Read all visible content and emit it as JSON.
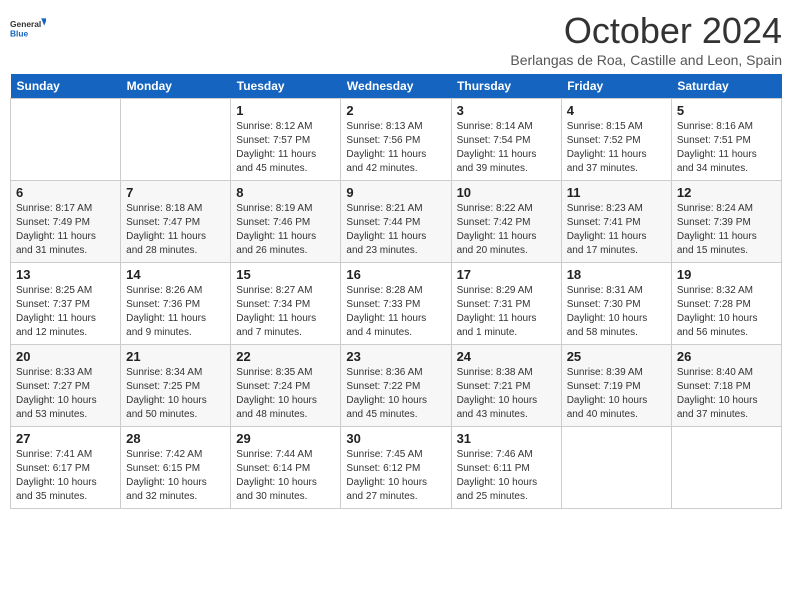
{
  "logo": {
    "line1": "General",
    "line2": "Blue"
  },
  "title": "October 2024",
  "location": "Berlangas de Roa, Castille and Leon, Spain",
  "days_of_week": [
    "Sunday",
    "Monday",
    "Tuesday",
    "Wednesday",
    "Thursday",
    "Friday",
    "Saturday"
  ],
  "weeks": [
    [
      {
        "day": "",
        "sunrise": "",
        "sunset": "",
        "daylight": ""
      },
      {
        "day": "",
        "sunrise": "",
        "sunset": "",
        "daylight": ""
      },
      {
        "day": "1",
        "sunrise": "Sunrise: 8:12 AM",
        "sunset": "Sunset: 7:57 PM",
        "daylight": "Daylight: 11 hours and 45 minutes."
      },
      {
        "day": "2",
        "sunrise": "Sunrise: 8:13 AM",
        "sunset": "Sunset: 7:56 PM",
        "daylight": "Daylight: 11 hours and 42 minutes."
      },
      {
        "day": "3",
        "sunrise": "Sunrise: 8:14 AM",
        "sunset": "Sunset: 7:54 PM",
        "daylight": "Daylight: 11 hours and 39 minutes."
      },
      {
        "day": "4",
        "sunrise": "Sunrise: 8:15 AM",
        "sunset": "Sunset: 7:52 PM",
        "daylight": "Daylight: 11 hours and 37 minutes."
      },
      {
        "day": "5",
        "sunrise": "Sunrise: 8:16 AM",
        "sunset": "Sunset: 7:51 PM",
        "daylight": "Daylight: 11 hours and 34 minutes."
      }
    ],
    [
      {
        "day": "6",
        "sunrise": "Sunrise: 8:17 AM",
        "sunset": "Sunset: 7:49 PM",
        "daylight": "Daylight: 11 hours and 31 minutes."
      },
      {
        "day": "7",
        "sunrise": "Sunrise: 8:18 AM",
        "sunset": "Sunset: 7:47 PM",
        "daylight": "Daylight: 11 hours and 28 minutes."
      },
      {
        "day": "8",
        "sunrise": "Sunrise: 8:19 AM",
        "sunset": "Sunset: 7:46 PM",
        "daylight": "Daylight: 11 hours and 26 minutes."
      },
      {
        "day": "9",
        "sunrise": "Sunrise: 8:21 AM",
        "sunset": "Sunset: 7:44 PM",
        "daylight": "Daylight: 11 hours and 23 minutes."
      },
      {
        "day": "10",
        "sunrise": "Sunrise: 8:22 AM",
        "sunset": "Sunset: 7:42 PM",
        "daylight": "Daylight: 11 hours and 20 minutes."
      },
      {
        "day": "11",
        "sunrise": "Sunrise: 8:23 AM",
        "sunset": "Sunset: 7:41 PM",
        "daylight": "Daylight: 11 hours and 17 minutes."
      },
      {
        "day": "12",
        "sunrise": "Sunrise: 8:24 AM",
        "sunset": "Sunset: 7:39 PM",
        "daylight": "Daylight: 11 hours and 15 minutes."
      }
    ],
    [
      {
        "day": "13",
        "sunrise": "Sunrise: 8:25 AM",
        "sunset": "Sunset: 7:37 PM",
        "daylight": "Daylight: 11 hours and 12 minutes."
      },
      {
        "day": "14",
        "sunrise": "Sunrise: 8:26 AM",
        "sunset": "Sunset: 7:36 PM",
        "daylight": "Daylight: 11 hours and 9 minutes."
      },
      {
        "day": "15",
        "sunrise": "Sunrise: 8:27 AM",
        "sunset": "Sunset: 7:34 PM",
        "daylight": "Daylight: 11 hours and 7 minutes."
      },
      {
        "day": "16",
        "sunrise": "Sunrise: 8:28 AM",
        "sunset": "Sunset: 7:33 PM",
        "daylight": "Daylight: 11 hours and 4 minutes."
      },
      {
        "day": "17",
        "sunrise": "Sunrise: 8:29 AM",
        "sunset": "Sunset: 7:31 PM",
        "daylight": "Daylight: 11 hours and 1 minute."
      },
      {
        "day": "18",
        "sunrise": "Sunrise: 8:31 AM",
        "sunset": "Sunset: 7:30 PM",
        "daylight": "Daylight: 10 hours and 58 minutes."
      },
      {
        "day": "19",
        "sunrise": "Sunrise: 8:32 AM",
        "sunset": "Sunset: 7:28 PM",
        "daylight": "Daylight: 10 hours and 56 minutes."
      }
    ],
    [
      {
        "day": "20",
        "sunrise": "Sunrise: 8:33 AM",
        "sunset": "Sunset: 7:27 PM",
        "daylight": "Daylight: 10 hours and 53 minutes."
      },
      {
        "day": "21",
        "sunrise": "Sunrise: 8:34 AM",
        "sunset": "Sunset: 7:25 PM",
        "daylight": "Daylight: 10 hours and 50 minutes."
      },
      {
        "day": "22",
        "sunrise": "Sunrise: 8:35 AM",
        "sunset": "Sunset: 7:24 PM",
        "daylight": "Daylight: 10 hours and 48 minutes."
      },
      {
        "day": "23",
        "sunrise": "Sunrise: 8:36 AM",
        "sunset": "Sunset: 7:22 PM",
        "daylight": "Daylight: 10 hours and 45 minutes."
      },
      {
        "day": "24",
        "sunrise": "Sunrise: 8:38 AM",
        "sunset": "Sunset: 7:21 PM",
        "daylight": "Daylight: 10 hours and 43 minutes."
      },
      {
        "day": "25",
        "sunrise": "Sunrise: 8:39 AM",
        "sunset": "Sunset: 7:19 PM",
        "daylight": "Daylight: 10 hours and 40 minutes."
      },
      {
        "day": "26",
        "sunrise": "Sunrise: 8:40 AM",
        "sunset": "Sunset: 7:18 PM",
        "daylight": "Daylight: 10 hours and 37 minutes."
      }
    ],
    [
      {
        "day": "27",
        "sunrise": "Sunrise: 7:41 AM",
        "sunset": "Sunset: 6:17 PM",
        "daylight": "Daylight: 10 hours and 35 minutes."
      },
      {
        "day": "28",
        "sunrise": "Sunrise: 7:42 AM",
        "sunset": "Sunset: 6:15 PM",
        "daylight": "Daylight: 10 hours and 32 minutes."
      },
      {
        "day": "29",
        "sunrise": "Sunrise: 7:44 AM",
        "sunset": "Sunset: 6:14 PM",
        "daylight": "Daylight: 10 hours and 30 minutes."
      },
      {
        "day": "30",
        "sunrise": "Sunrise: 7:45 AM",
        "sunset": "Sunset: 6:12 PM",
        "daylight": "Daylight: 10 hours and 27 minutes."
      },
      {
        "day": "31",
        "sunrise": "Sunrise: 7:46 AM",
        "sunset": "Sunset: 6:11 PM",
        "daylight": "Daylight: 10 hours and 25 minutes."
      },
      {
        "day": "",
        "sunrise": "",
        "sunset": "",
        "daylight": ""
      },
      {
        "day": "",
        "sunrise": "",
        "sunset": "",
        "daylight": ""
      }
    ]
  ]
}
